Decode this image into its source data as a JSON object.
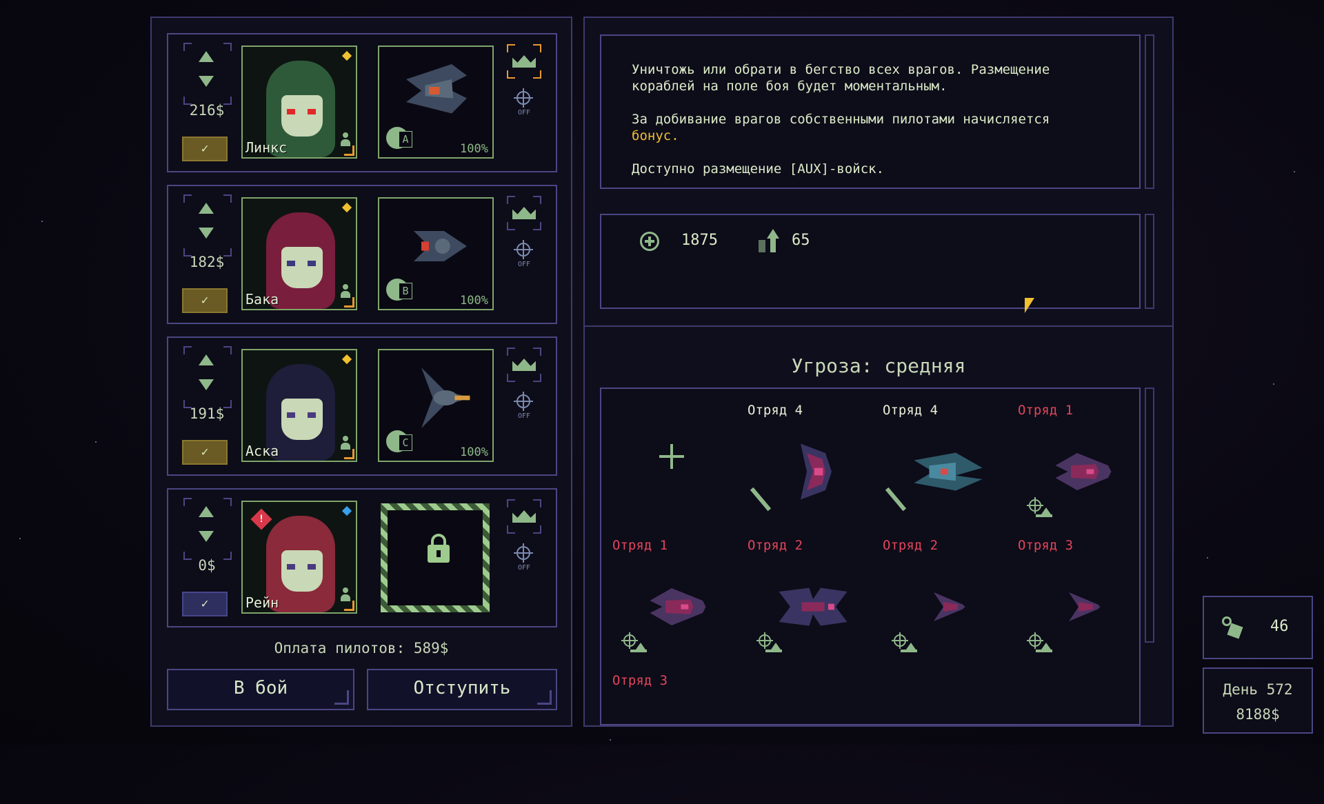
{
  "pilots": [
    {
      "name": "Линкс",
      "salary": "216$",
      "hull": "100%",
      "slot": "A",
      "selected": true,
      "hair": "#2e5a3a",
      "eyes": "#e02828",
      "dot": "yellow",
      "crown": "orange"
    },
    {
      "name": "Бака",
      "salary": "182$",
      "hull": "100%",
      "slot": "B",
      "selected": true,
      "hair": "#7a1e3e",
      "eyes": "#3a3a7e",
      "dot": "yellow",
      "crown": "normal"
    },
    {
      "name": "Аска",
      "salary": "191$",
      "hull": "100%",
      "slot": "C",
      "selected": true,
      "hair": "#1e1e3a",
      "eyes": "#4a3a7e",
      "dot": "yellow",
      "crown": "normal"
    },
    {
      "name": "Рейн",
      "salary": "0$",
      "locked": true,
      "selected": false,
      "hair": "#8a2a3a",
      "eyes": "#4a3a7e",
      "dot": "blue",
      "alert": "!",
      "crown": "normal"
    }
  ],
  "pilot_pay_label": "Оплата пилотов: 589$",
  "buttons": {
    "fight": "В бой",
    "retreat": "Отступить"
  },
  "target_off_label": "OFF",
  "description": {
    "line1": "Уничтожь или обрати в бегство всех врагов. Размещение",
    "line2": "кораблей на поле боя будет моментальным.",
    "line3": "За добивание врагов собственными пилотами начисляется",
    "line4": "бонус.",
    "line5": "Доступно размещение [AUX]-войск."
  },
  "rewards": {
    "credits": "1875",
    "xp": "65"
  },
  "threat_label": "Угроза: средняя",
  "squads": [
    {
      "label": "Отряд 4",
      "color": "w",
      "ship": "tall",
      "sword": true
    },
    {
      "label": "Отряд 4",
      "color": "w",
      "ship": "claw",
      "sword": true
    },
    {
      "label": "Отряд 1",
      "color": "r",
      "ship": "medium",
      "target": true
    },
    {
      "label": "Отряд 1",
      "color": "r",
      "ship": "medium",
      "target": true
    },
    {
      "label": "Отряд 2",
      "color": "r",
      "ship": "wide",
      "target": true
    },
    {
      "label": "Отряд 2",
      "color": "r",
      "ship": "small",
      "target": true
    },
    {
      "label": "Отряд 3",
      "color": "r",
      "ship": "small",
      "target": true
    },
    {
      "label": "Отряд 3",
      "color": "r",
      "ship": "none",
      "target": false
    }
  ],
  "resources": {
    "parts": "46",
    "day": "День 572",
    "money": "8188$"
  },
  "colors": {
    "accent_green": "#8fb88a",
    "border_purple": "#4a4784",
    "enemy_red": "#e0455a",
    "gold": "#f0c030"
  }
}
